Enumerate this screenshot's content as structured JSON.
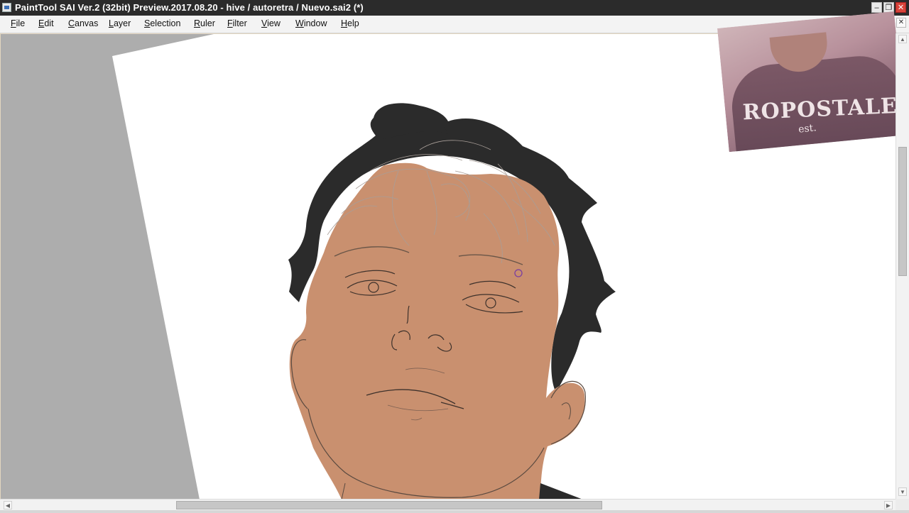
{
  "window": {
    "title": "PaintTool SAI Ver.2 (32bit) Preview.2017.08.20 - hive / autoretra / Nuevo.sai2 (*)",
    "minimize_glyph": "–",
    "restore_glyph": "❐",
    "close_glyph": "✕"
  },
  "menu": {
    "items": [
      {
        "label": "File",
        "accel": "F",
        "rest": "ile"
      },
      {
        "label": "Edit",
        "accel": "E",
        "rest": "dit"
      },
      {
        "label": "Canvas",
        "accel": "C",
        "rest": "anvas"
      },
      {
        "label": "Layer",
        "accel": "L",
        "rest": "ayer"
      },
      {
        "label": "Selection",
        "accel": "S",
        "rest": "election"
      },
      {
        "label": "Ruler",
        "accel": "R",
        "rest": "uler"
      },
      {
        "label": "Filter",
        "accel": "F",
        "rest": "ilter"
      },
      {
        "label": "View",
        "accel": "V",
        "rest": "iew"
      },
      {
        "label": "Window",
        "accel": "W",
        "rest": "indow"
      },
      {
        "label": "Help",
        "accel": "H",
        "rest": "elp"
      }
    ]
  },
  "mdi_controls": {
    "minimize_glyph": "–",
    "restore_glyph": "❐",
    "close_glyph": "✕"
  },
  "scrollbars": {
    "up_glyph": "▲",
    "down_glyph": "▼",
    "left_glyph": "◀",
    "right_glyph": "▶"
  },
  "webcam": {
    "shirt_text": "ROPOSTALE",
    "shirt_sub": "est."
  },
  "colors": {
    "titlebar": "#2b2b2b",
    "workspace_gray": "#adadad",
    "skin_flat": "#c9906f",
    "hair": "#2b2b2b",
    "line_art": "#5a4a40",
    "brush_cursor": "#7a3fa0"
  }
}
